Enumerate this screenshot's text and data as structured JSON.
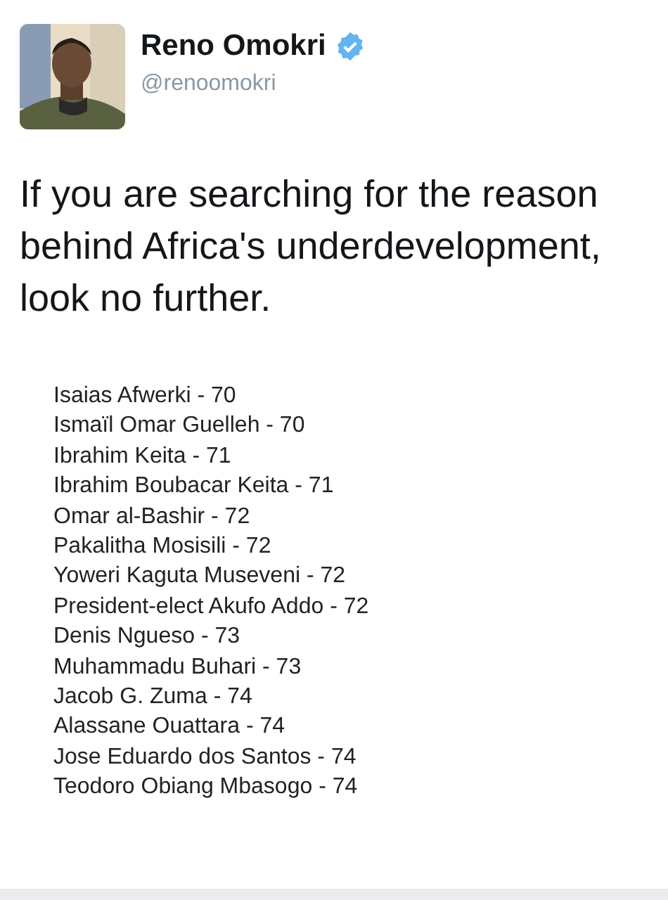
{
  "author": {
    "name": "Reno Omokri",
    "verified": true,
    "handle": "@renoomokri"
  },
  "tweet_text": "If you are searching for the reason behind Africa's underdevelopment, look no further.",
  "attached_image": {
    "lines": [
      "Isaias Afwerki - 70",
      "Ismaïl Omar Guelleh - 70",
      "Ibrahim Keita - 71",
      "Ibrahim Boubacar Keita - 71",
      "Omar al-Bashir - 72",
      "Pakalitha Mosisili - 72",
      "Yoweri Kaguta Museveni - 72",
      "President-elect Akufo Addo - 72",
      "Denis Ngueso - 73",
      "Muhammadu Buhari - 73",
      "Jacob G. Zuma - 74",
      "Alassane Ouattara - 74",
      "Jose Eduardo dos Santos - 74",
      "Teodoro Obiang Mbasogo - 74"
    ]
  }
}
